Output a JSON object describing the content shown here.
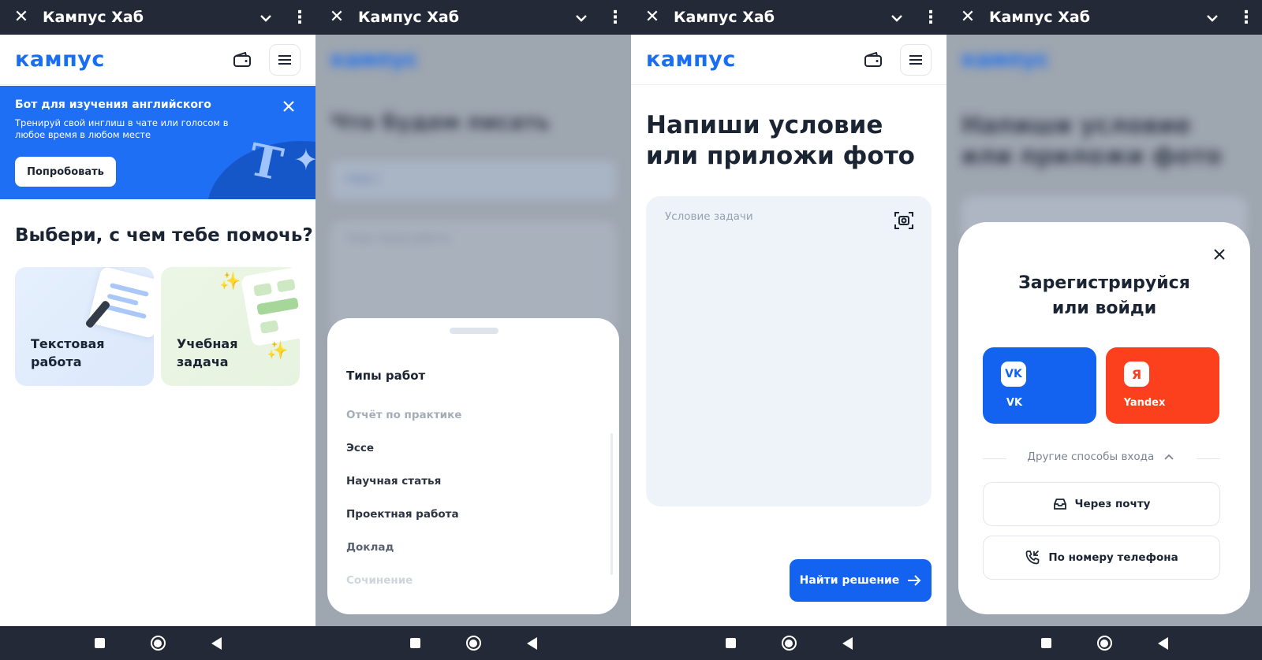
{
  "topbar": {
    "title": "Кампус Хаб"
  },
  "header": {
    "logo": "кампус"
  },
  "screen1": {
    "banner": {
      "title": "Бот для изучения английского",
      "text": "Тренируй свой инглиш в чате или голосом в любое время в любом месте",
      "button": "Попробовать",
      "decor_letter": "T"
    },
    "title": "Выбери, с чем тебе помочь?",
    "cards": [
      {
        "label_line1": "Текстовая",
        "label_line2": "работа"
      },
      {
        "label_line1": "Учебная",
        "label_line2": "задача"
      }
    ]
  },
  "screen2": {
    "blurred_title": "Что будем писать",
    "blurred_select": "Работ",
    "blurred_field": "Тема твоей работы",
    "sheet_title": "Типы работ",
    "items": [
      "Отчёт по практике",
      "Эссе",
      "Научная статья",
      "Проектная работа",
      "Доклад",
      "Сочинение"
    ]
  },
  "screen3": {
    "title": "Напиши условие или приложи фото",
    "placeholder": "Условие задачи",
    "button": "Найти решение"
  },
  "screen4": {
    "blurred_title": "Напиши условие или приложи фото",
    "modal_title_line1": "Зарегистрируйся",
    "modal_title_line2": "или войди",
    "vk": {
      "badge": "VK",
      "label": "VK"
    },
    "yandex": {
      "badge": "Я",
      "label": "Yandex"
    },
    "other_methods": "Другие способы входа",
    "email_button": "Через почту",
    "phone_button": "По номеру телефона"
  },
  "colors": {
    "brand": "#1a6ef2",
    "topbar": "#232936",
    "vk": "#1463f0",
    "yandex": "#fc3f1d"
  }
}
